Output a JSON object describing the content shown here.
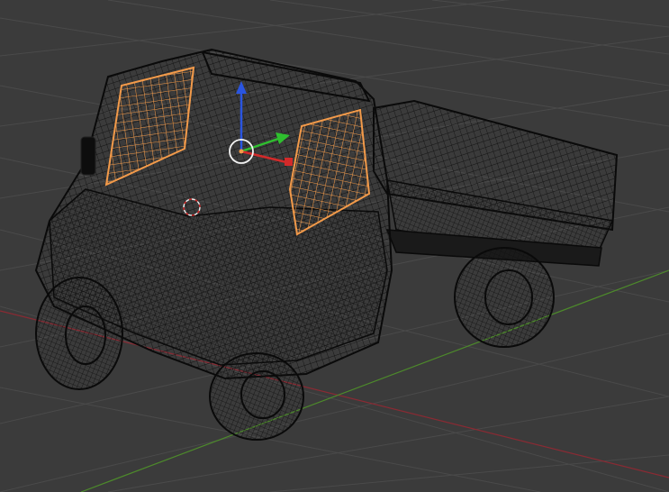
{
  "viewport": {
    "view": "3D Viewport",
    "shading": "wireframe",
    "background_color": "#3b3b3b",
    "grid_color": "#4a4a4a",
    "x_axis_color": "#8a2a33",
    "y_axis_color": "#4d8a2b",
    "wire_color": "#0a0a0a",
    "selection_color": "#f29a4a"
  },
  "scene": {
    "object": "truck-mesh",
    "selected_parts": [
      "left-door-window",
      "right-door-window"
    ]
  },
  "gizmo": {
    "type": "translate",
    "axes": [
      {
        "name": "x-axis",
        "color": "#d22a2a"
      },
      {
        "name": "y-axis",
        "color": "#2fbf2f"
      },
      {
        "name": "z-axis",
        "color": "#2a55e0"
      }
    ]
  },
  "cursor_3d": {
    "icon": "3d-cursor-icon"
  }
}
